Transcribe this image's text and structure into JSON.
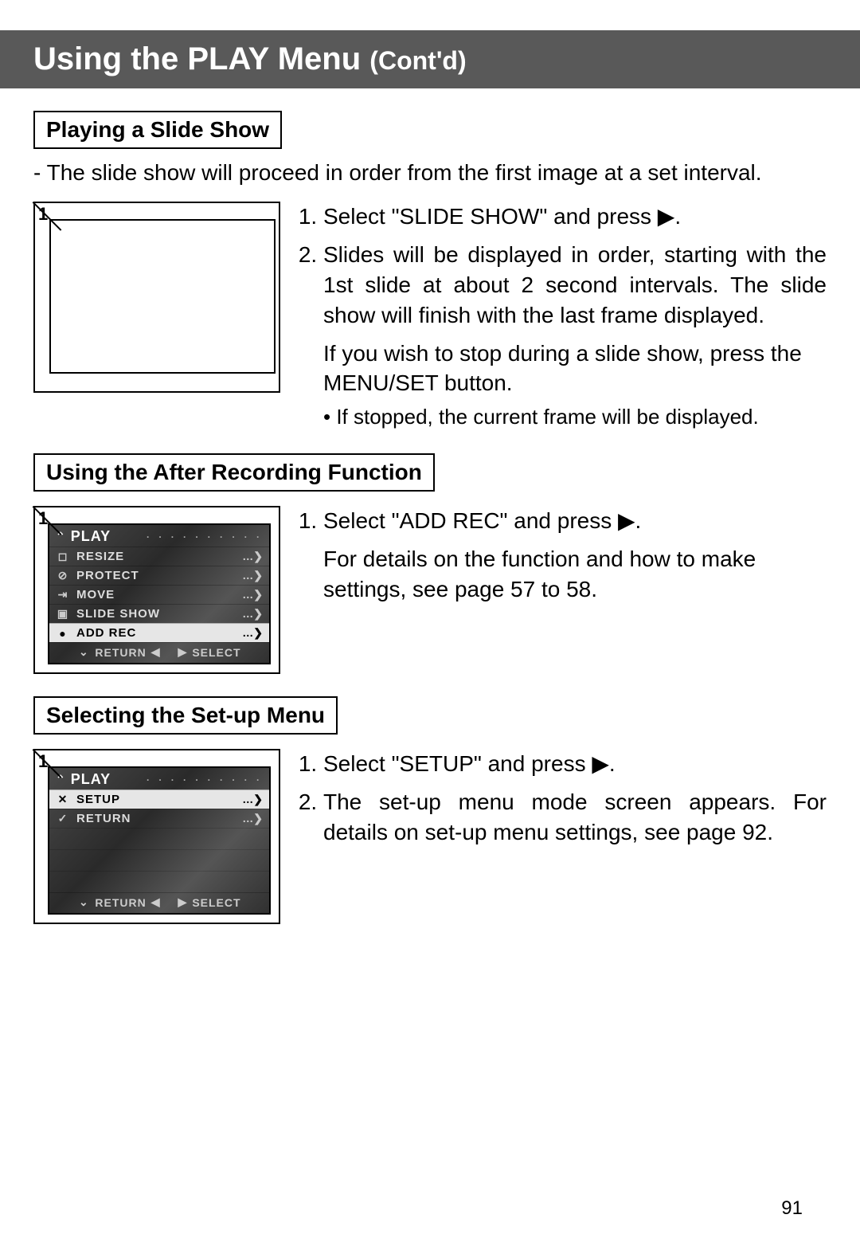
{
  "title": {
    "main": "Using the PLAY Menu ",
    "contd": "Cont'd)",
    "paren": "("
  },
  "page_number": "91",
  "section1": {
    "heading": "Playing a Slide Show",
    "lead": "- The slide show will proceed in order from the first image at a set interval.",
    "fig_label": "1",
    "step1": "Select \"SLIDE SHOW\" and press ▶.",
    "step2": "Slides will be displayed in order, starting with the 1st slide at about 2 second intervals. The slide show will finish with the last frame displayed.",
    "extra": "If you wish to stop during a slide show, press the MENU/SET button.",
    "bullet": "If stopped, the current frame will be displayed."
  },
  "section2": {
    "heading": "Using the After Recording Function",
    "fig_label": "1",
    "step1": "Select \"ADD REC\" and press ▶.",
    "extra": "For details on the function and how to make settings, see page 57 to 58.",
    "lcd": {
      "header": "PLAY",
      "rows": [
        {
          "icon": "◻",
          "label": "RESIZE",
          "selected": false
        },
        {
          "icon": "⊘",
          "label": "PROTECT",
          "selected": false
        },
        {
          "icon": "⇥",
          "label": "MOVE",
          "selected": false
        },
        {
          "icon": "▣",
          "label": "SLIDE SHOW",
          "selected": false
        },
        {
          "icon": "●",
          "label": "ADD REC",
          "selected": true
        }
      ],
      "footer_return": "RETURN",
      "footer_select": "SELECT"
    }
  },
  "section3": {
    "heading": "Selecting the Set-up Menu",
    "fig_label": "1",
    "step1": "Select \"SETUP\" and press ▶.",
    "step2": "The set-up menu mode screen appears. For details on set-up menu settings, see page 92.",
    "lcd": {
      "header": "PLAY",
      "rows": [
        {
          "icon": "✕",
          "label": "SETUP",
          "selected": true
        },
        {
          "icon": "✓",
          "label": "RETURN",
          "selected": false
        }
      ],
      "footer_return": "RETURN",
      "footer_select": "SELECT"
    }
  }
}
